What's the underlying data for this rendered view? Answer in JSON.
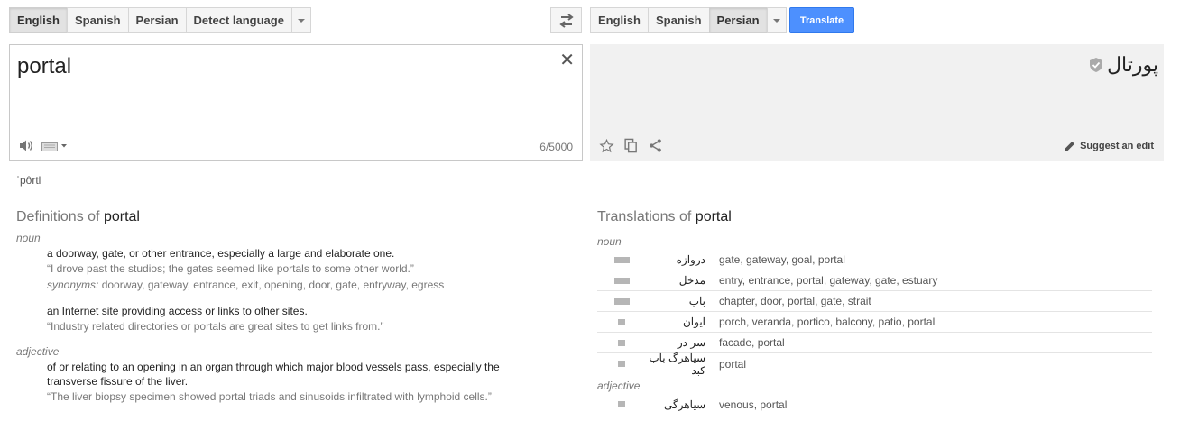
{
  "source_langs": {
    "items": [
      "English",
      "Spanish",
      "Persian",
      "Detect language"
    ],
    "active": 0
  },
  "target_langs": {
    "items": [
      "English",
      "Spanish",
      "Persian"
    ],
    "active": 2
  },
  "translate_label": "Translate",
  "source": {
    "text": "portal",
    "counter": "6/5000"
  },
  "result": {
    "text": "پورتال",
    "suggest_label": "Suggest an edit"
  },
  "phonetic": "ˈpôrtl",
  "definitions": {
    "title_prefix": "Definitions of",
    "word": "portal",
    "groups": [
      {
        "pos": "noun",
        "entries": [
          {
            "gloss": "a doorway, gate, or other entrance, especially a large and elaborate one.",
            "example": "“I drove past the studios; the gates seemed like portals to some other world.”",
            "syn_label": "synonyms:",
            "synonyms": "doorway, gateway, entrance, exit, opening, door, gate, entryway, egress"
          },
          {
            "gloss": "an Internet site providing access or links to other sites.",
            "example": "“Industry related directories or portals are great sites to get links from.”"
          }
        ]
      },
      {
        "pos": "adjective",
        "entries": [
          {
            "gloss": "of or relating to an opening in an organ through which major blood vessels pass, especially the transverse fissure of the liver.",
            "example": "“The liver biopsy specimen showed portal triads and sinusoids infiltrated with lymphoid cells.”"
          }
        ]
      }
    ]
  },
  "translations": {
    "title_prefix": "Translations of",
    "word": "portal",
    "groups": [
      {
        "pos": "noun",
        "rows": [
          {
            "fa": "دروازه",
            "en": "gate, gateway, goal, portal",
            "freq": 0.85
          },
          {
            "fa": "مدخل",
            "en": "entry, entrance, portal, gateway, gate, estuary",
            "freq": 0.85
          },
          {
            "fa": "باب",
            "en": "chapter, door, portal, gate, strait",
            "freq": 0.85
          },
          {
            "fa": "ایوان",
            "en": "porch, veranda, portico, balcony, patio, portal",
            "freq": 0.4
          },
          {
            "fa": "سر در",
            "en": "facade, portal",
            "freq": 0.4
          },
          {
            "fa": "سیاهرگ باب کبد",
            "en": "portal",
            "freq": 0.4
          }
        ]
      },
      {
        "pos": "adjective",
        "rows": [
          {
            "fa": "سیاهرگی",
            "en": "venous, portal",
            "freq": 0.4
          }
        ]
      }
    ]
  }
}
